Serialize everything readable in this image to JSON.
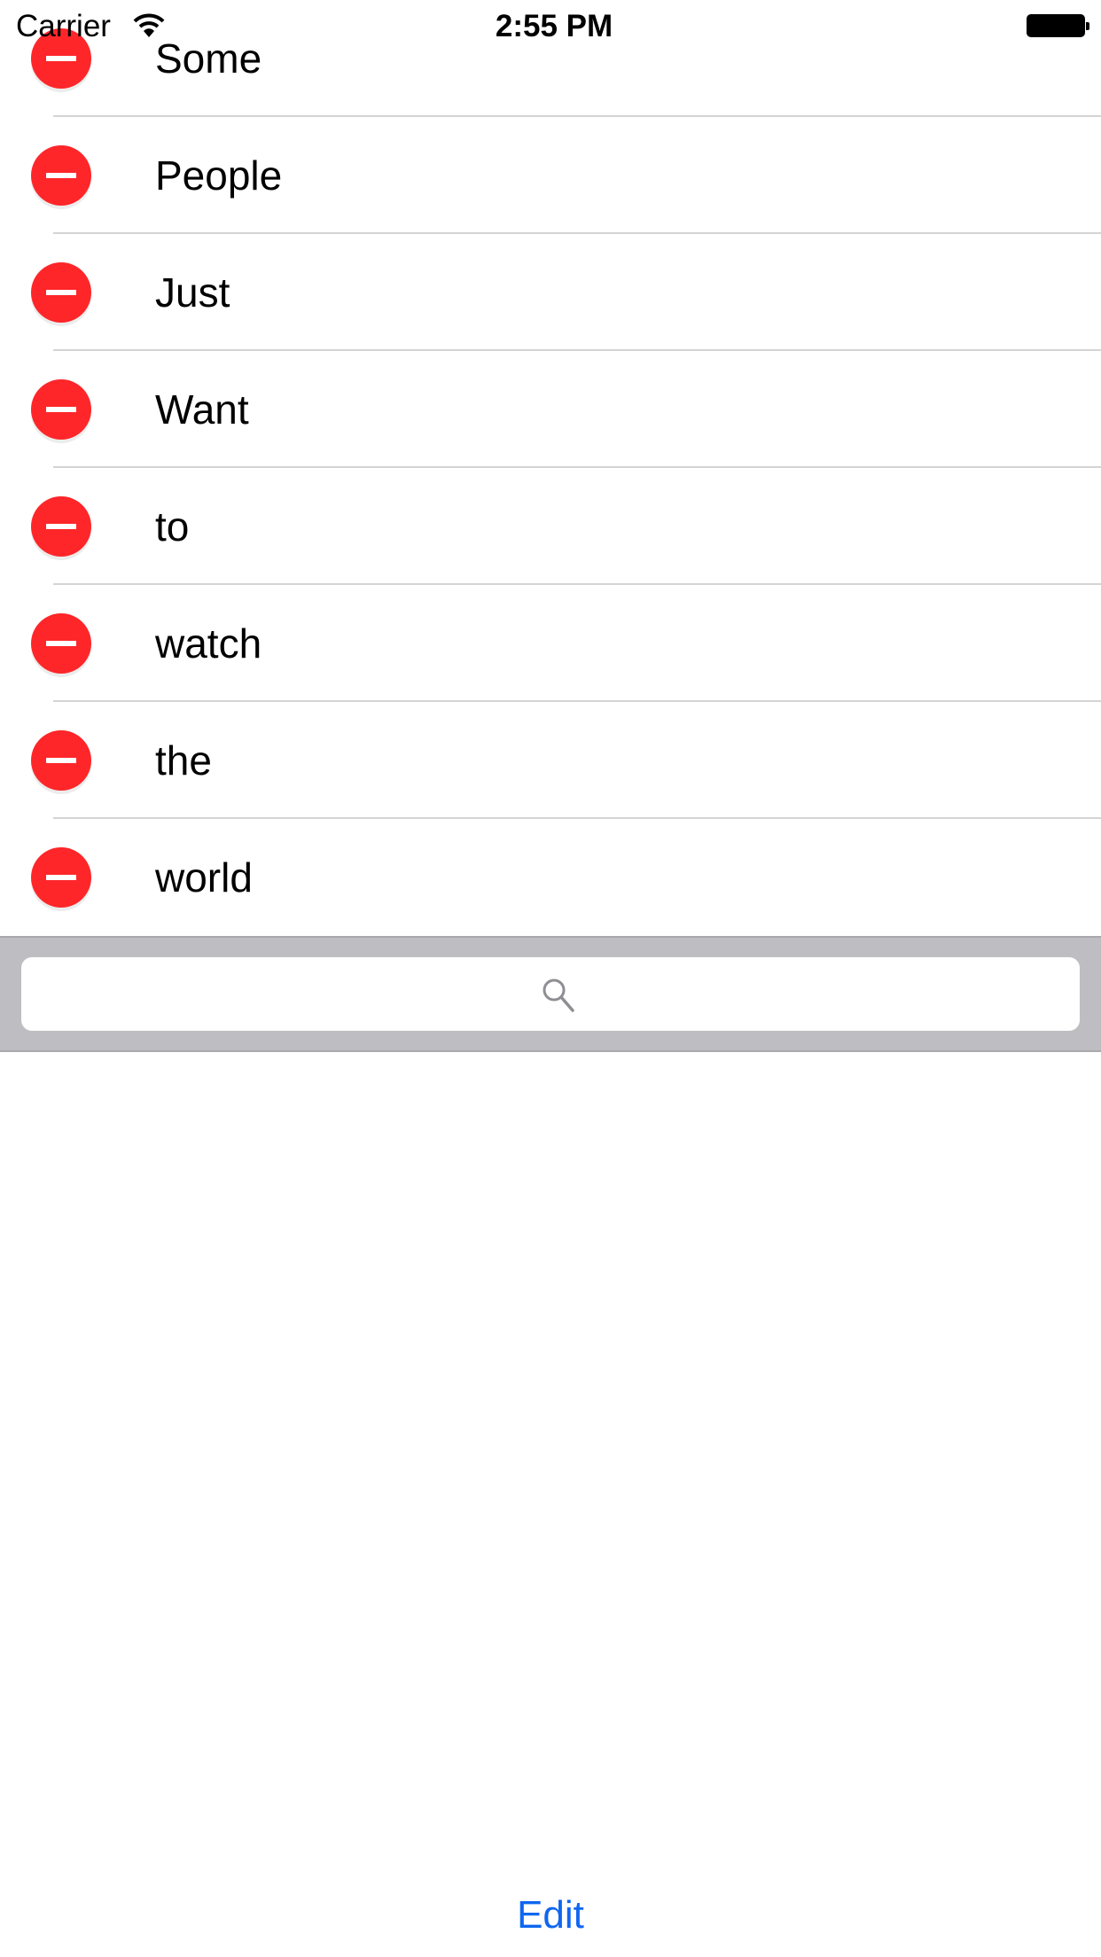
{
  "status_bar": {
    "carrier": "Carrier",
    "time": "2:55 PM"
  },
  "list": {
    "items": [
      {
        "label": "Some"
      },
      {
        "label": "People"
      },
      {
        "label": "Just"
      },
      {
        "label": "Want"
      },
      {
        "label": "to"
      },
      {
        "label": "watch"
      },
      {
        "label": "the"
      },
      {
        "label": "world"
      }
    ]
  },
  "search": {
    "value": "",
    "placeholder": ""
  },
  "toolbar": {
    "edit_label": "Edit"
  },
  "colors": {
    "delete": "#fe2629",
    "accent": "#0f66f0",
    "searchbar_bg": "#bdbdc2"
  }
}
